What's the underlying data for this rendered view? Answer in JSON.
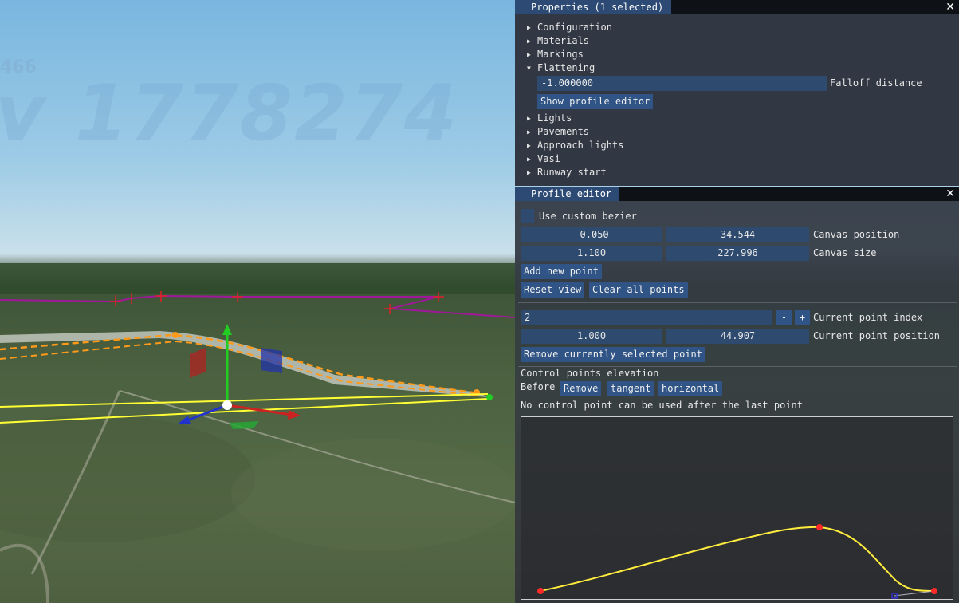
{
  "viewport": {
    "overlay_number_small": "466",
    "overlay_number_big": "v 1778274",
    "colors": {
      "sky": "#8fc3e3",
      "ground": "#4b6140",
      "runway_edge": "#ffff33",
      "flatten_line": "#ff9a1a",
      "boundary": "#a0189a"
    }
  },
  "properties": {
    "title": "Properties (1 selected)",
    "items": [
      {
        "label": "Configuration",
        "expanded": false
      },
      {
        "label": "Materials",
        "expanded": false
      },
      {
        "label": "Markings",
        "expanded": false
      },
      {
        "label": "Flattening",
        "expanded": true
      },
      {
        "label": "Lights",
        "expanded": false
      },
      {
        "label": "Pavements",
        "expanded": false
      },
      {
        "label": "Approach lights",
        "expanded": false
      },
      {
        "label": "Vasi",
        "expanded": false
      },
      {
        "label": "Runway start",
        "expanded": false
      }
    ],
    "flattening": {
      "falloff_value": "-1.000000",
      "falloff_label": "Falloff distance",
      "show_profile_button": "Show profile editor"
    },
    "arrow_collapsed": "▶",
    "arrow_expanded": "▼"
  },
  "profile_editor": {
    "title": "Profile editor",
    "use_custom_bezier_label": "Use custom bezier",
    "use_custom_bezier_checked": false,
    "canvas_position": {
      "x": "-0.050",
      "y": "34.544",
      "label": "Canvas position"
    },
    "canvas_size": {
      "x": "1.100",
      "y": "227.996",
      "label": "Canvas size"
    },
    "add_point_button": "Add new point",
    "reset_view_button": "Reset view",
    "clear_points_button": "Clear all points",
    "current_index": {
      "value": "2",
      "minus": "-",
      "plus": "+",
      "label": "Current point index"
    },
    "current_position": {
      "x": "1.000",
      "y": "44.907",
      "label": "Current point position"
    },
    "remove_point_button": "Remove currently selected point",
    "control_points_heading": "Control points elevation",
    "before_label": "Before",
    "before_buttons": [
      "Remove",
      "tangent",
      "horizontal"
    ],
    "after_note": "No control point can be used after the last point",
    "curve_color": "#ffec3d",
    "point_color": "#ff2a2a"
  },
  "close_glyph": "✕"
}
